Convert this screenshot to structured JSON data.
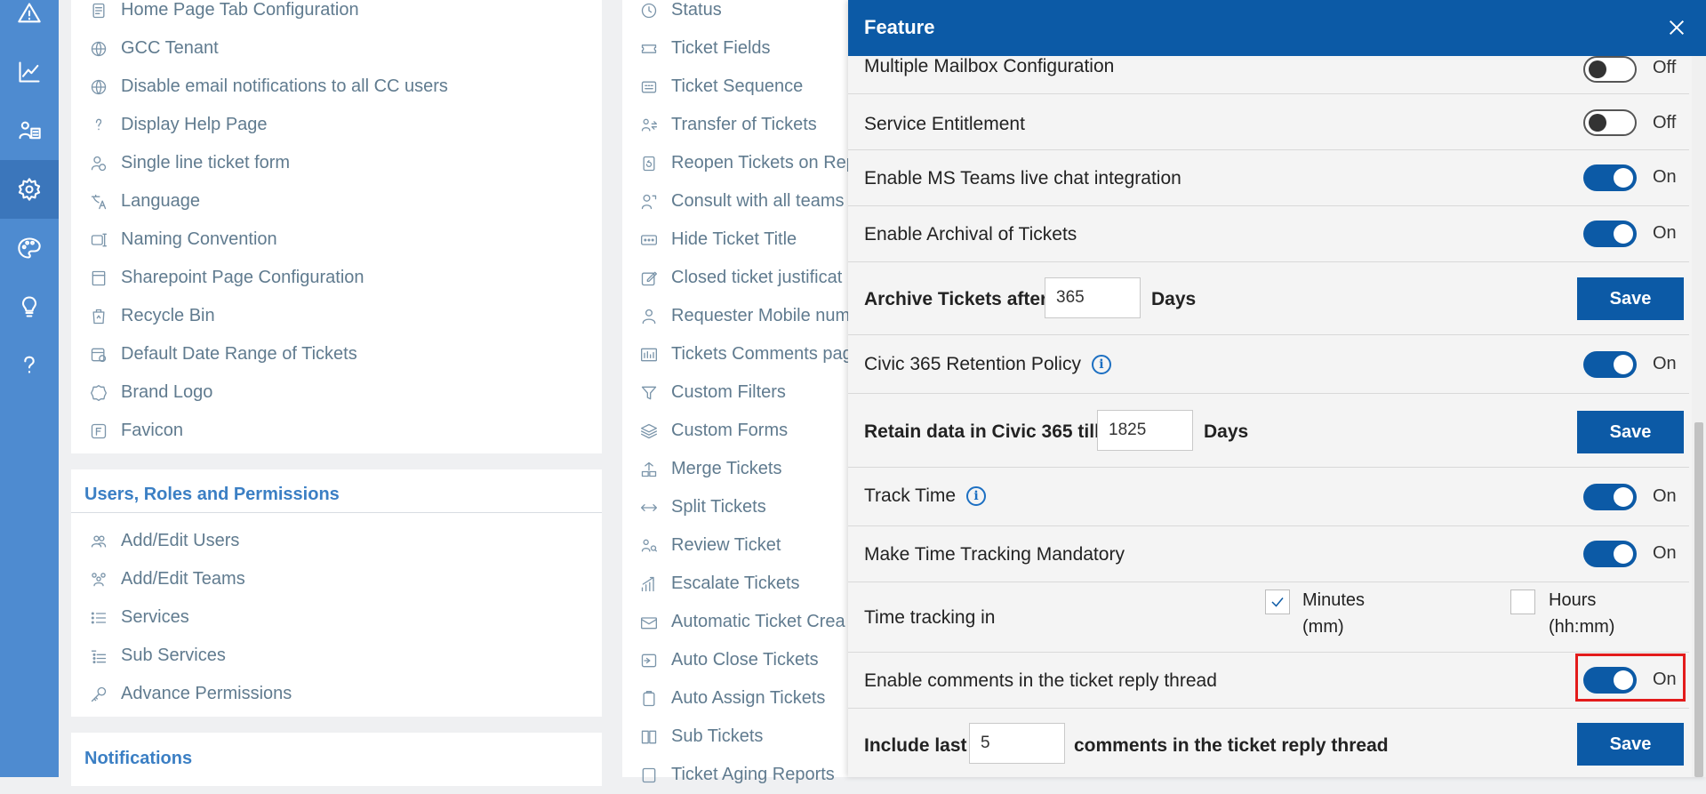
{
  "rail": [
    {
      "name": "alert-icon"
    },
    {
      "name": "analytics-icon"
    },
    {
      "name": "users-icon"
    },
    {
      "name": "settings-icon"
    },
    {
      "name": "palette-icon"
    },
    {
      "name": "lightbulb-icon"
    },
    {
      "name": "help-icon"
    }
  ],
  "col1": {
    "items": [
      {
        "label": "Home Page Tab Configuration",
        "icon": "document-icon"
      },
      {
        "label": "GCC Tenant",
        "icon": "globe-icon"
      },
      {
        "label": "Disable email notifications to all CC users",
        "icon": "globe-icon"
      },
      {
        "label": "Display Help Page",
        "icon": "question-icon"
      },
      {
        "label": "Single line ticket form",
        "icon": "user-settings-icon"
      },
      {
        "label": "Language",
        "icon": "translate-icon"
      },
      {
        "label": "Naming Convention",
        "icon": "rename-icon"
      },
      {
        "label": "Sharepoint Page Configuration",
        "icon": "page-icon"
      },
      {
        "label": "Recycle Bin",
        "icon": "recycle-bin-icon"
      },
      {
        "label": "Default Date Range of Tickets",
        "icon": "calendar-clock-icon"
      },
      {
        "label": "Brand Logo",
        "icon": "badge-icon"
      },
      {
        "label": "Favicon",
        "icon": "favicon-icon"
      }
    ],
    "section_users": "Users, Roles and Permissions",
    "users_items": [
      {
        "label": "Add/Edit Users",
        "icon": "people-icon"
      },
      {
        "label": "Add/Edit Teams",
        "icon": "team-icon"
      },
      {
        "label": "Services",
        "icon": "list-icon"
      },
      {
        "label": "Sub Services",
        "icon": "sub-list-icon"
      },
      {
        "label": "Advance Permissions",
        "icon": "key-icon"
      }
    ],
    "section_notifications": "Notifications"
  },
  "col2": {
    "items": [
      {
        "label": "Status",
        "icon": "status-icon"
      },
      {
        "label": "Ticket Fields",
        "icon": "ticket-icon"
      },
      {
        "label": "Ticket Sequence",
        "icon": "sequence-icon"
      },
      {
        "label": "Transfer of Tickets",
        "icon": "transfer-icon"
      },
      {
        "label": "Reopen Tickets on Rep",
        "icon": "reopen-icon"
      },
      {
        "label": "Consult with all teams",
        "icon": "consult-icon"
      },
      {
        "label": "Hide Ticket Title",
        "icon": "dots-icon"
      },
      {
        "label": "Closed ticket justificat",
        "icon": "edit-icon"
      },
      {
        "label": "Requester Mobile num",
        "icon": "person-icon"
      },
      {
        "label": "Tickets Comments pag",
        "icon": "comments-page-icon"
      },
      {
        "label": "Custom Filters",
        "icon": "filter-icon"
      },
      {
        "label": "Custom Forms",
        "icon": "layers-icon"
      },
      {
        "label": "Merge Tickets",
        "icon": "merge-icon"
      },
      {
        "label": "Split Tickets",
        "icon": "split-icon"
      },
      {
        "label": "Review Ticket",
        "icon": "review-icon"
      },
      {
        "label": "Escalate Tickets",
        "icon": "escalate-icon"
      },
      {
        "label": "Automatic Ticket Crea",
        "icon": "mail-ticket-icon"
      },
      {
        "label": "Auto Close Tickets",
        "icon": "auto-close-icon"
      },
      {
        "label": "Auto Assign Tickets",
        "icon": "clipboard-icon"
      },
      {
        "label": "Sub Tickets",
        "icon": "sub-tickets-icon"
      },
      {
        "label": "Ticket Aging Reports",
        "icon": "report-icon"
      }
    ]
  },
  "drawer": {
    "title": "Feature",
    "close_icon": "close-icon",
    "rows": {
      "multi_mailbox": {
        "label": "Multiple Mailbox Configuration",
        "state": "Off"
      },
      "service_entitlement": {
        "label": "Service Entitlement",
        "state": "Off"
      },
      "ms_teams": {
        "label": "Enable MS Teams live chat integration",
        "state": "On"
      },
      "archival": {
        "label": "Enable Archival of Tickets",
        "state": "On"
      },
      "archive_after": {
        "prefix": "Archive Tickets after",
        "value": "365",
        "suffix": "Days",
        "button": "Save"
      },
      "retention": {
        "label": "Civic 365 Retention Policy",
        "info": "i",
        "state": "On"
      },
      "retain_data": {
        "prefix": "Retain data in Civic 365 till",
        "value": "1825",
        "suffix": "Days",
        "button": "Save"
      },
      "track_time": {
        "label": "Track Time",
        "info": "i",
        "state": "On"
      },
      "time_mandatory": {
        "label": "Make Time Tracking Mandatory",
        "state": "On"
      },
      "time_in": {
        "label": "Time tracking in",
        "minutes": "Minutes",
        "minutes_unit": "(mm)",
        "minutes_checked": true,
        "hours": "Hours",
        "hours_unit": "(hh:mm)",
        "hours_checked": false
      },
      "comments_thread": {
        "label": "Enable comments in the ticket reply thread",
        "state": "On"
      },
      "include_last": {
        "prefix": "Include last",
        "value": "5",
        "suffix": "comments in the ticket reply thread",
        "button": "Save"
      }
    }
  },
  "colors": {
    "rail": "#4e8bd0",
    "header": "#0c5aa6",
    "toggle_on": "#0c5aa6",
    "highlight": "#e31b1b",
    "section_title": "#3b7fc4"
  }
}
